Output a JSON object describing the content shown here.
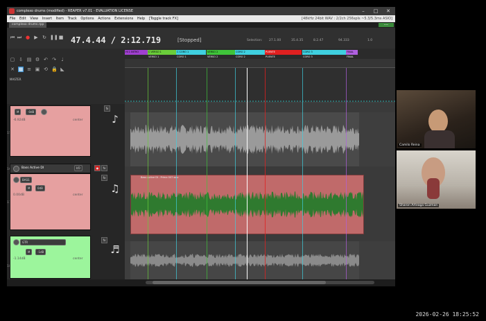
{
  "window": {
    "title": "complexo drums (modified) - REAPER v7.01 - EVALUATION LICENSE",
    "minimize": "–",
    "maximize": "□",
    "close": "✕"
  },
  "menu": {
    "items": [
      "File",
      "Edit",
      "View",
      "Insert",
      "Item",
      "Track",
      "Options",
      "Actions",
      "Extensions",
      "Help",
      "[Toggle track FX]"
    ],
    "status": "[48kHz 24bit WAV : 2/2ch 256spls ~5.3/5.3ms ASIO]"
  },
  "project_tab": {
    "label": "complexo drums.rpp",
    "badge": "•••"
  },
  "transport": {
    "time": "47.4.44 / 2:12.719",
    "state": "[Stopped]",
    "selection_label": "Selection:",
    "sel_start": "27.1.00",
    "sel_end": "35.4.35",
    "sel_length": "8.2.47",
    "bpm": "94.333",
    "rate": "1.0"
  },
  "regions_row1": [
    {
      "label": "HI 1 INTRO",
      "color": "#a040d0"
    },
    {
      "label": "C VERSO 1",
      "color": "#6acd3a"
    },
    {
      "label": "C CORO 1",
      "color": "#3fd0e0"
    },
    {
      "label": "VERSO 2",
      "color": "#3fc43a"
    },
    {
      "label": "CORO 2",
      "color": "#3fd0e0"
    },
    {
      "label": "PUENTE",
      "color": "#e02020"
    },
    {
      "label": "CORO 3",
      "color": "#3fd0e0"
    },
    {
      "label": "FINAL",
      "color": "#b060e0"
    }
  ],
  "regions_row2": [
    "VERSO 1",
    "CORO 1",
    "VERSO 2",
    "CORO 2",
    "PUENTE",
    "CORO 3",
    "FINAL"
  ],
  "mixer_label": "MASTER",
  "tracks": [
    {
      "number": "15",
      "name": "",
      "vol_label": "-6.92dB",
      "pan_label": "center",
      "color": "#e6a0a0"
    },
    {
      "number": "16",
      "name": "Bass Active DI",
      "vol_label": "",
      "pan_label": "",
      "color": "#b95a5a"
    },
    {
      "number": "17",
      "name": "BASS",
      "vol_label": "0.00dB",
      "pan_label": "center",
      "color": "#e6a0a0"
    },
    {
      "number": "18",
      "name": "GTR",
      "vol_label": "-1.14dB",
      "pan_label": "center",
      "color": "#9cf59c"
    }
  ],
  "item_label": "Bass Active DI - Prima 007.wav",
  "participants": [
    {
      "name": "Camilo Reina"
    },
    {
      "name": "Sharon Arteaga Guzman"
    }
  ],
  "timestamp": "2026-02-26  18:25:52",
  "colors": {
    "bass_item": "#c06a6a",
    "waveform_green": "#2f7a2f",
    "playhead": "#ffffff"
  }
}
